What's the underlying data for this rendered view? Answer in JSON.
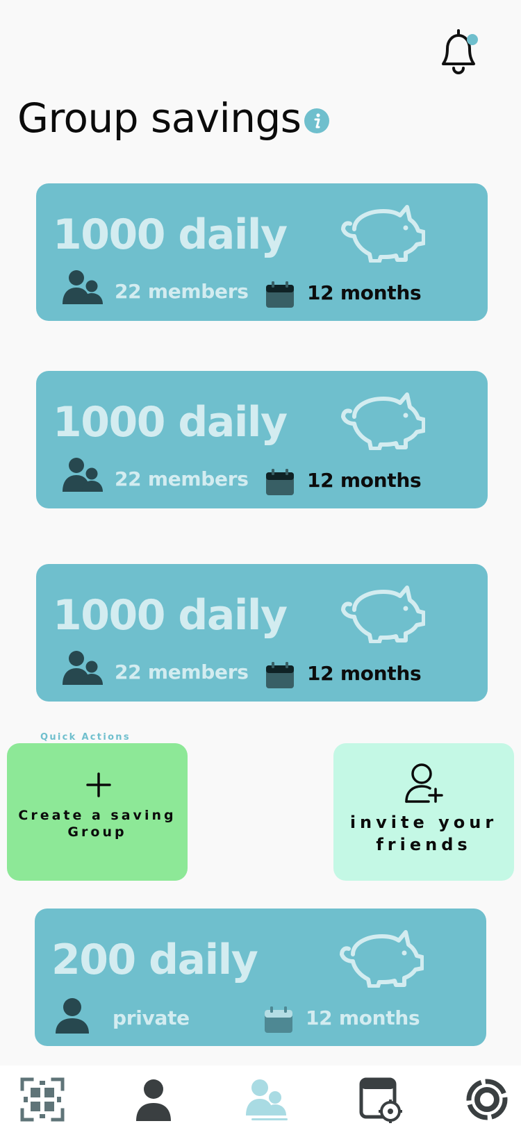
{
  "header": {
    "title": "Group savings",
    "info_icon": "info-icon",
    "notification_icon": "bell-icon",
    "notification_dot_color": "#6fbfcd"
  },
  "cards": [
    {
      "amount": "1000 daily",
      "members": "22 members",
      "duration": "12 months",
      "icon": "piggy-bank-icon"
    },
    {
      "amount": "1000 daily",
      "members": "22 members",
      "duration": "12 months",
      "icon": "piggy-bank-icon"
    },
    {
      "amount": "1000 daily",
      "members": "22 members",
      "duration": "12 months",
      "icon": "piggy-bank-icon"
    }
  ],
  "quick_actions": {
    "label": "Quick Actions",
    "create": {
      "label": "Create a saving Group",
      "icon": "plus-icon"
    },
    "invite": {
      "label": "invite your friends",
      "icon": "add-user-icon"
    }
  },
  "private_card": {
    "amount": "200 daily",
    "visibility": "private",
    "duration": "12 months",
    "icon": "piggy-bank-icon"
  },
  "tabbar": {
    "items": [
      {
        "icon": "scan-qr-icon",
        "active": false
      },
      {
        "icon": "profile-icon",
        "active": false
      },
      {
        "icon": "groups-icon",
        "active": true
      },
      {
        "icon": "calendar-target-icon",
        "active": false
      },
      {
        "icon": "settings-ring-icon",
        "active": false
      }
    ]
  },
  "colors": {
    "background": "#f9f9f9",
    "card": "#6fbfcd",
    "card_text": "#d3ecf0",
    "create_action": "#8de897",
    "invite_action": "#c4f8e5",
    "icon_dark": "#27484f"
  }
}
